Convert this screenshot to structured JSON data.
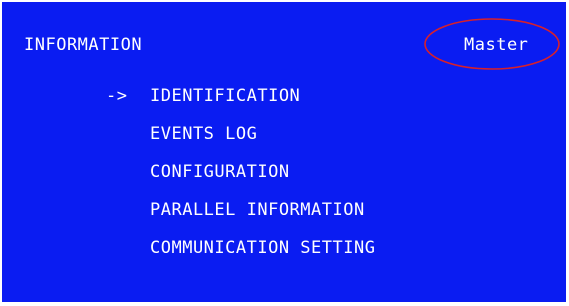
{
  "screen": {
    "background_color": "#0a1cf2",
    "text_color": "#ffffff",
    "title": "INFORMATION",
    "mode": "Master",
    "highlight_color": "#d8202a"
  },
  "menu": {
    "cursor_glyph": "->",
    "selected_index": 0,
    "items": [
      {
        "label": "IDENTIFICATION"
      },
      {
        "label": "EVENTS LOG"
      },
      {
        "label": "CONFIGURATION"
      },
      {
        "label": "PARALLEL INFORMATION"
      },
      {
        "label": "COMMUNICATION SETTING"
      }
    ]
  }
}
